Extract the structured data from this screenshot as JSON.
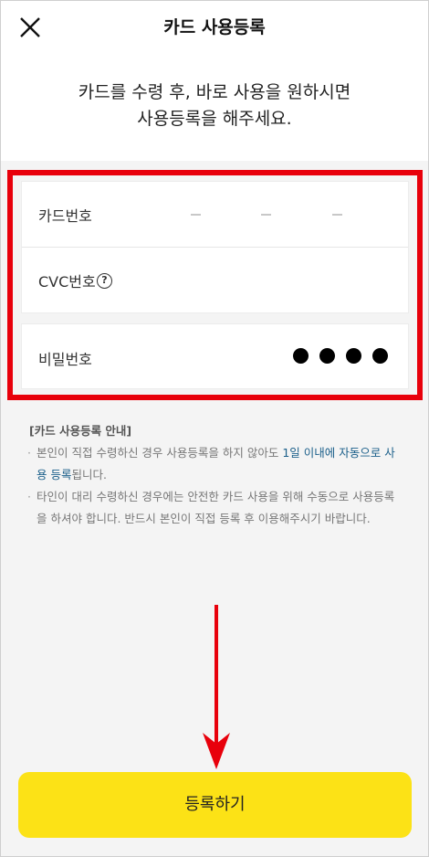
{
  "header": {
    "title": "카드 사용등록",
    "close_icon": "close-icon"
  },
  "guide": {
    "line1": "카드를 수령 후, 바로 사용을 원하시면",
    "line2": "사용등록을 해주세요."
  },
  "form": {
    "card_number_label": "카드번호",
    "cvc_label": "CVC번호",
    "cvc_help_glyph": "?",
    "password_label": "비밀번호",
    "password_dots": 4
  },
  "notice": {
    "title": "[카드 사용등록 안내]",
    "item1_pre": "본인이 직접 수령하신 경우 사용등록을 하지 않아도 ",
    "item1_highlight": "1일 이내에 자동으로 사용 등록",
    "item1_post": "됩니다.",
    "item2": "타인이 대리 수령하신 경우에는 안전한 카드 사용을 위해 수동으로 사용등록을 하셔야 합니다. 반드시 본인이 직접 등록 후 이용해주시기 바랍니다."
  },
  "footer": {
    "register_label": "등록하기"
  },
  "colors": {
    "highlight_box": "#e8000b",
    "primary_button": "#fce216",
    "link_text": "#1b5f8a",
    "arrow": "#e8000b"
  }
}
